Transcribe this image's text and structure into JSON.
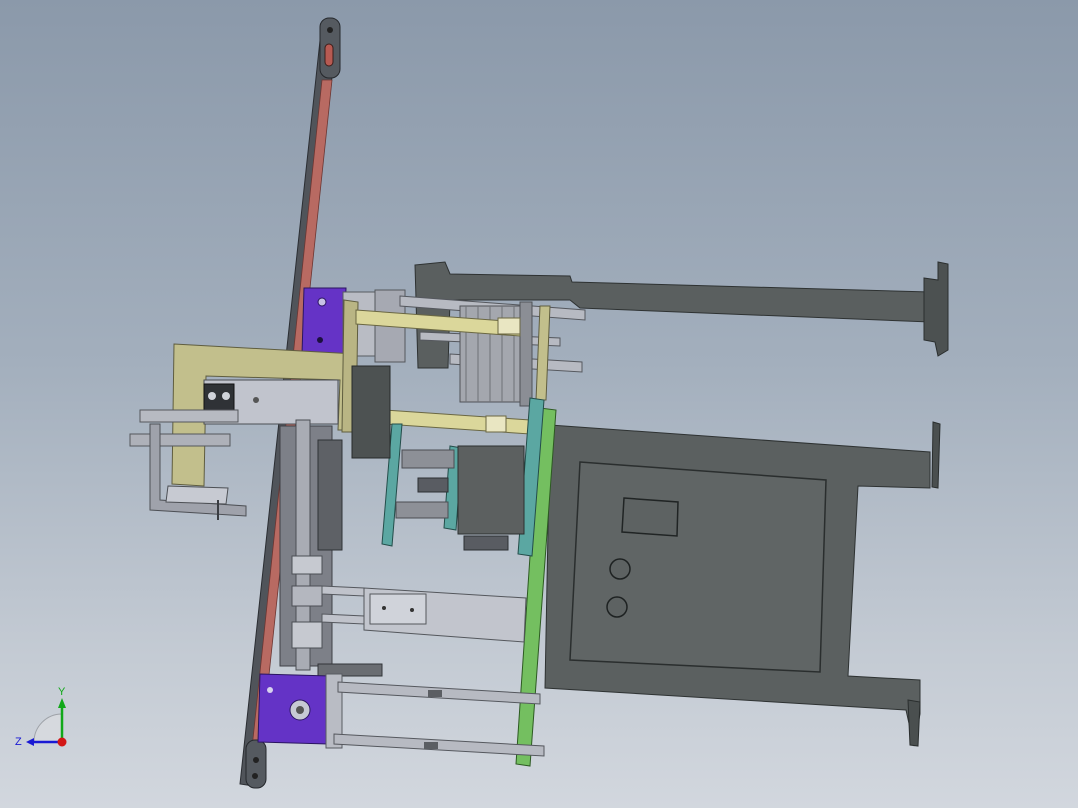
{
  "viewport": {
    "background_top": "#8b99aa",
    "background_bottom": "#d2d7de"
  },
  "triad": {
    "y_label": "Y",
    "z_label": "Z",
    "colors": {
      "y": "#11a81a",
      "z": "#1919d4",
      "x": "#d21616"
    }
  },
  "model": {
    "colors": {
      "frame": "#595e5e",
      "frame_dark": "#404545",
      "rail": "#ba6b63",
      "purple_block": "#6433c6",
      "khaki_bracket": "#c2bf8e",
      "cylinder_yellow": "#dbd79b",
      "green_plate": "#75c061",
      "teal_plate": "#5ba7a2",
      "light_metal": "#c5c8d2",
      "mid_metal": "#9ea1aa"
    }
  }
}
